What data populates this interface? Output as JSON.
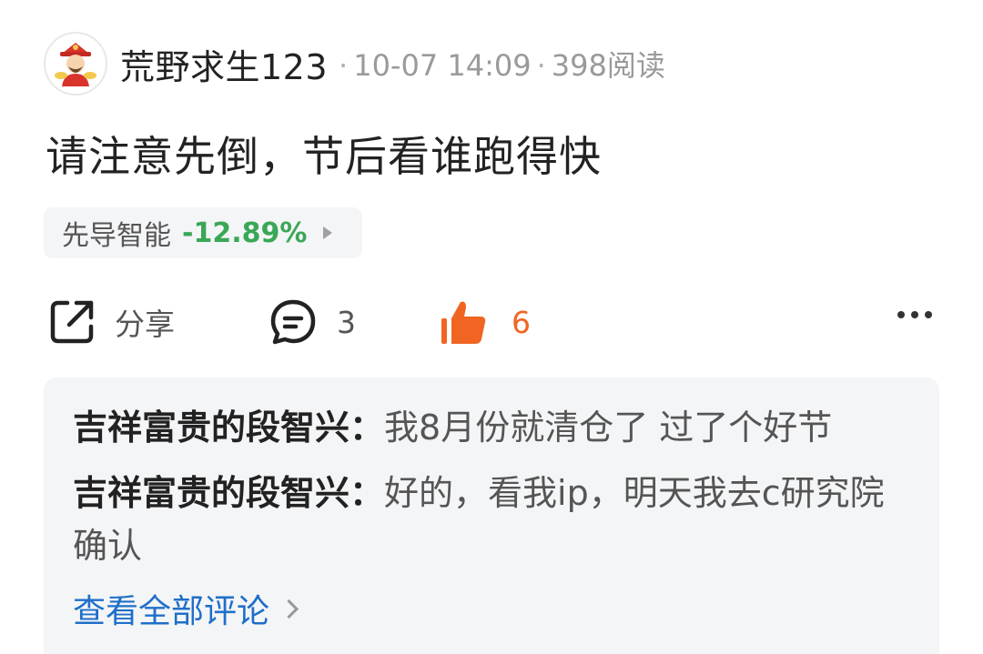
{
  "post": {
    "author": "荒野求生123",
    "separator": "·",
    "time": "10-07 14:09",
    "reads": "398阅读",
    "text": "请注意先倒，节后看谁跑得快"
  },
  "stock": {
    "name": "先导智能",
    "change": "-12.89%",
    "change_color": "#3aa757"
  },
  "actions": {
    "share_label": "分享",
    "comment_count": "3",
    "like_count": "6",
    "like_color": "#f06522"
  },
  "icons": {
    "share": "share-icon",
    "comment": "comment-icon",
    "like": "thumbs-up-icon",
    "more": "more-icon",
    "chevron": "chevron-right-icon"
  },
  "comments": [
    {
      "author": "吉祥富贵的段智兴：",
      "text": "我8月份就清仓了 过了个好节"
    },
    {
      "author": "吉祥富贵的段智兴：",
      "text": "好的，看我ip，明天我去c研究院确认"
    }
  ],
  "view_all_label": "查看全部评论"
}
